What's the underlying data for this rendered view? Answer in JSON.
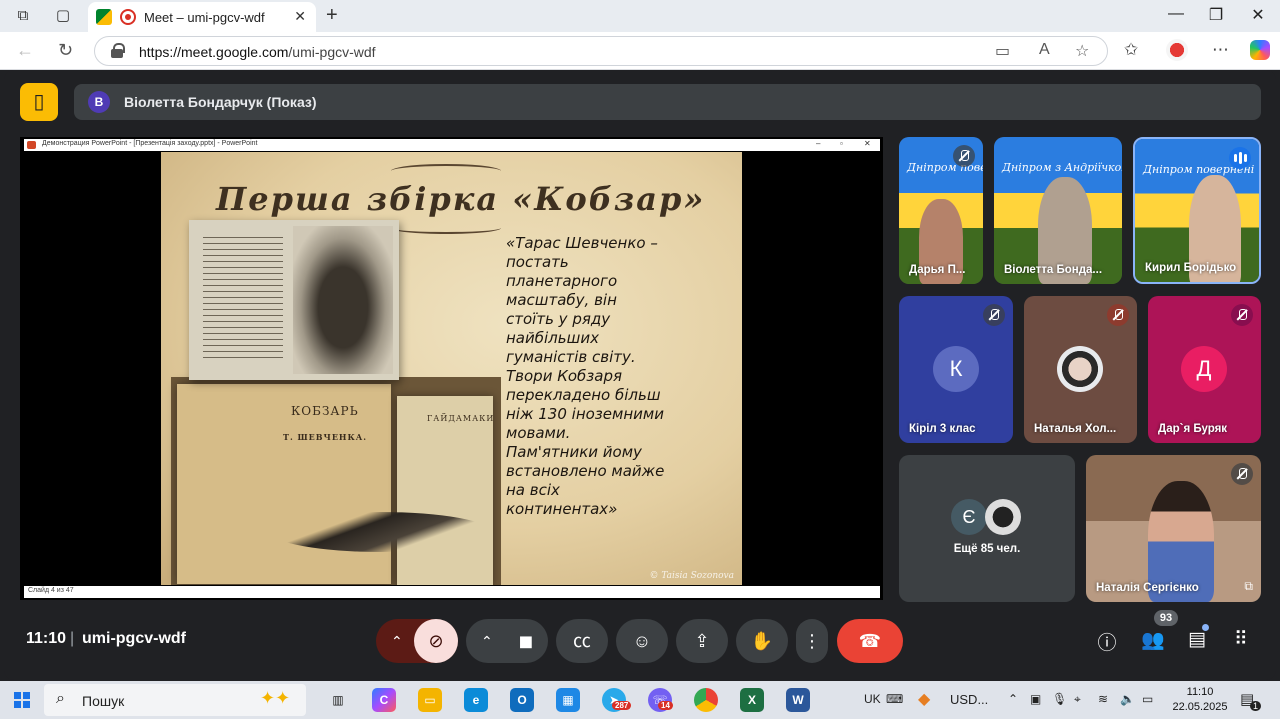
{
  "browser": {
    "tab_title": "Meet – umi-pgcv-wdf",
    "url_host": "https://meet.google.com",
    "url_path": "/umi-pgcv-wdf"
  },
  "meet": {
    "presenter_initial": "В",
    "presenter_label": "Віолетта Бондарчук (Показ)",
    "time": "11:10",
    "meeting_code": "umi-pgcv-wdf",
    "participant_count": "93"
  },
  "screen_share": {
    "window_title": "Демонстрация PowerPoint - [Презентація заходу.pptx] - PowerPoint",
    "slide_status": "Слайд 4 из 47",
    "slide_title": "Перша збірка «Кобзар»",
    "quote": "«Тарас Шевченко –\nпостать\nпланетарного\nмасштабу, він\nстоїть у ряду\nнайбільших\nгуманістів світу.\nТвори Кобзаря\nперекладено більш\nніж 130 іноземними\nмовами.\nПам'ятники йому\nвстановлено майже\nна всіх\nконтинентах»",
    "book1_title": "КОБЗАРЬ",
    "book1_author": "Т. ШЕВЧЕНКА.",
    "book2_title": "ГАЙДАМАКИ",
    "watermark": "© Taisia Sozonova"
  },
  "participants": [
    {
      "name": "Дарья П...",
      "muted": true
    },
    {
      "name": "Віолетта Бонда...",
      "muted": false
    },
    {
      "name": "Кирил Борідько",
      "muted": false,
      "speaking": true
    },
    {
      "name": "Кіріл 3 клас",
      "initial": "К",
      "muted": true,
      "color": "#3f51b5"
    },
    {
      "name": "Наталья Хол...",
      "muted": true
    },
    {
      "name": "Дар`я Буряк",
      "initial": "Д",
      "muted": true,
      "color": "#e91e63"
    },
    {
      "name": "Наталія Сергієнко",
      "muted": true
    }
  ],
  "more_participants": {
    "label": "Ещё 85 чел.",
    "initial": "Є"
  },
  "tile_banner": [
    "Дніпром повернені",
    "Дніпром з Андріїчком",
    "Дніпром повернені"
  ],
  "taskbar": {
    "search_label": "Пошук",
    "telegram_badge": "287",
    "viber_badge": "14",
    "lang": "UK",
    "currency": "USD...",
    "clock_time": "11:10",
    "clock_date": "22.05.2025",
    "notif_count": "1"
  },
  "colors": {
    "accent": "#1a73e8",
    "end_call": "#ea4335",
    "mute_active": "#f9dedc",
    "meet_bg": "#202124"
  }
}
